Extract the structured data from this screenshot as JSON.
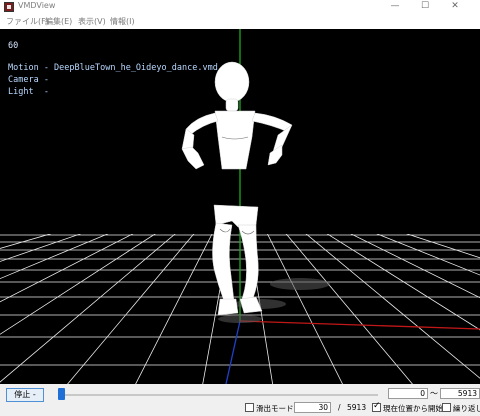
{
  "window": {
    "title": "VMDView",
    "minimize": "—",
    "maximize": "☐",
    "close": "✕"
  },
  "menu": [
    "ファイル(F)",
    "編集(E)",
    "表示(V)",
    "情報(I)"
  ],
  "overlay": {
    "fps": "60",
    "motion": "Motion - DeepBlueTown_he_Oideyo_dance.vmd",
    "camera": "Camera -",
    "light": "Light  -"
  },
  "controls": {
    "stop_label": "停止 -",
    "range_from": "0",
    "range_tilde": "〜",
    "range_to": "5913",
    "smooth_label": "滑出モード",
    "smooth_checked": false,
    "current_frame": "30",
    "slash": "/",
    "total_frames": "5913",
    "start_from_current_label": "現在位置から開始",
    "start_from_current_checked": true,
    "loop_label": "繰り返し",
    "loop_checked": false,
    "playback_position": 0.005
  },
  "colors": {
    "viewport_bg": "#000000",
    "grid": "#ffffff",
    "axis_y": "#1fa81f",
    "axis_x": "#c01818",
    "axis_z": "#2040c8",
    "accent": "#1f6fd6"
  },
  "icons": {
    "app": "mmd-app-icon",
    "minimize": "minimize-icon",
    "maximize": "maximize-icon",
    "close": "close-icon"
  }
}
